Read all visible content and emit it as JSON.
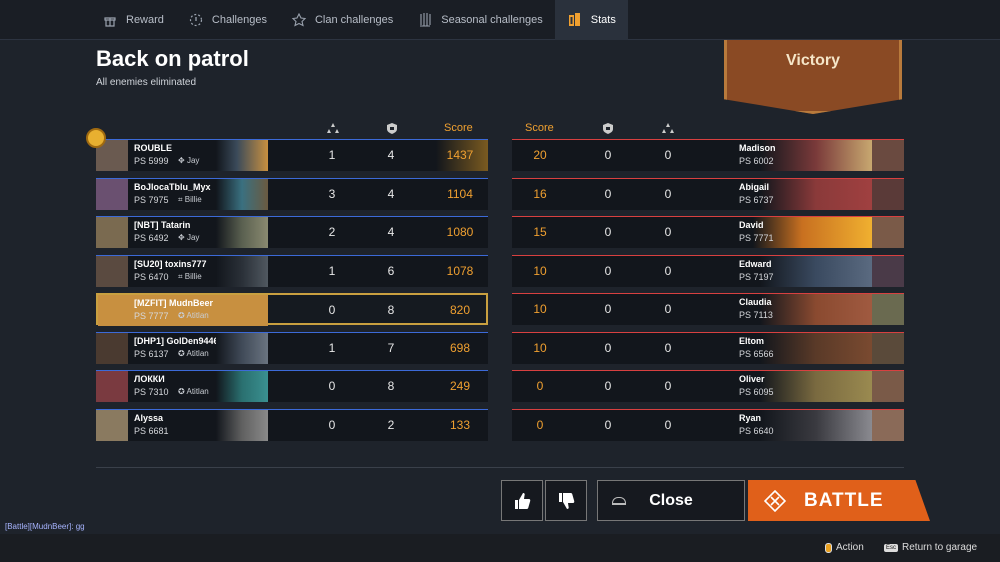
{
  "tabs": [
    {
      "label": "Reward",
      "icon": "reward-icon"
    },
    {
      "label": "Challenges",
      "icon": "challenges-icon"
    },
    {
      "label": "Clan challenges",
      "icon": "clan-challenges-icon"
    },
    {
      "label": "Seasonal challenges",
      "icon": "seasonal-challenges-icon"
    },
    {
      "label": "Stats",
      "icon": "stats-icon",
      "active": true
    }
  ],
  "page": {
    "title": "Back on patrol",
    "subtitle": "All enemies eliminated",
    "result": "Victory"
  },
  "headers": {
    "score": "Score"
  },
  "left_team": [
    {
      "name": "ROUBLE",
      "ps": "PS 5999",
      "pilot": "Jay",
      "kills": "1",
      "assists": "4",
      "score": "1437"
    },
    {
      "name": "BoJlocaTblu_Myx",
      "ps": "PS 7975",
      "pilot": "Billie",
      "kills": "3",
      "assists": "4",
      "score": "1104"
    },
    {
      "name": "[NBT] Tatarin",
      "ps": "PS 6492",
      "pilot": "Jay",
      "kills": "2",
      "assists": "4",
      "score": "1080"
    },
    {
      "name": "[SU20] toxins777",
      "ps": "PS 6470",
      "pilot": "Billie",
      "kills": "1",
      "assists": "6",
      "score": "1078"
    },
    {
      "name": "[MZFIT] MudnBeer",
      "ps": "PS 7777",
      "pilot": "Atitlan",
      "kills": "0",
      "assists": "8",
      "score": "820"
    },
    {
      "name": "[DHP1] GolDen94462",
      "ps": "PS 6137",
      "pilot": "Atitlan",
      "kills": "1",
      "assists": "7",
      "score": "698"
    },
    {
      "name": "ЛОККИ",
      "ps": "PS 7310",
      "pilot": "Atitlan",
      "kills": "0",
      "assists": "8",
      "score": "249"
    },
    {
      "name": "Alyssa",
      "ps": "PS 6681",
      "pilot": "",
      "kills": "0",
      "assists": "2",
      "score": "133"
    }
  ],
  "right_team": [
    {
      "name": "Madison",
      "ps": "PS 6002",
      "score": "20",
      "assists": "0",
      "kills": "0"
    },
    {
      "name": "Abigail",
      "ps": "PS 6737",
      "score": "16",
      "assists": "0",
      "kills": "0"
    },
    {
      "name": "David",
      "ps": "PS 7771",
      "score": "15",
      "assists": "0",
      "kills": "0"
    },
    {
      "name": "Edward",
      "ps": "PS 7197",
      "score": "10",
      "assists": "0",
      "kills": "0"
    },
    {
      "name": "Claudia",
      "ps": "PS 7113",
      "score": "10",
      "assists": "0",
      "kills": "0"
    },
    {
      "name": "Eltom",
      "ps": "PS 6566",
      "score": "10",
      "assists": "0",
      "kills": "0"
    },
    {
      "name": "Oliver",
      "ps": "PS 6095",
      "score": "0",
      "assists": "0",
      "kills": "0"
    },
    {
      "name": "Ryan",
      "ps": "PS 6640",
      "score": "0",
      "assists": "0",
      "kills": "0"
    }
  ],
  "buttons": {
    "close": "Close",
    "battle": "BATTLE"
  },
  "chat": "[Battle][MudnBeer]: gg",
  "hints": {
    "action": "Action",
    "esc_key": "Esc",
    "return": "Return to garage"
  },
  "colors": {
    "accent": "#f0a030",
    "battle": "#e0601a",
    "ally_line": "#3c6ad8",
    "enemy_line": "#d84040",
    "highlight": "#c9a040"
  }
}
